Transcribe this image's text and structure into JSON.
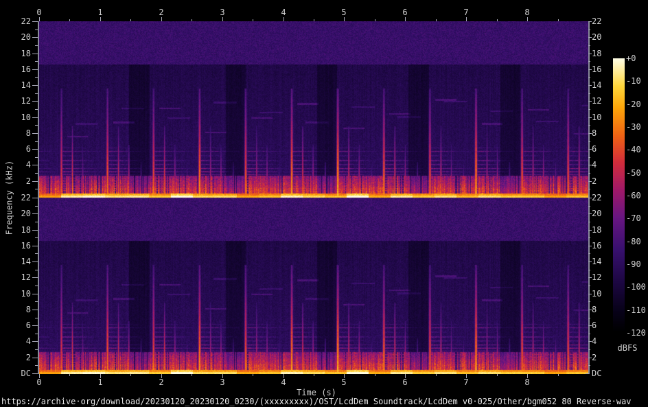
{
  "meta": {
    "app": "audio spectrogram view",
    "description": "Dual-channel (stereo) audio spectrogram with dBFS colorbar"
  },
  "colors": {
    "background": "#000000",
    "text": "#d2d2d2",
    "tick": "#a8a8b8",
    "border": "#8a8a9c",
    "footer_text": "#e6e6e6"
  },
  "footer": {
    "source_text": "https://archive·org/download/20230120_20230120_0230/(xxxxxxxxx)/OST/LcdDem Soundtrack/LcdDem v0·025/Other/bgm052 80 Reverse·wav"
  },
  "chart_data": {
    "type": "heatmap",
    "subtype": "stereo-audio-spectrogram",
    "channels": 2,
    "x_axis": {
      "label": "Time (s)",
      "min": 0,
      "max": 9.0,
      "major_ticks": [
        0,
        1,
        2,
        3,
        4,
        5,
        6,
        7,
        8
      ],
      "major_tick_labels": [
        "0",
        "1",
        "2",
        "3",
        "4",
        "5",
        "6",
        "7",
        "8"
      ],
      "minor_tick_step": 0.5
    },
    "y_axis": {
      "label": "Frequency (kHz)",
      "min_khz": 0,
      "max_khz": 22,
      "major_tick_labels": [
        "22",
        "20",
        "18",
        "16",
        "14",
        "12",
        "10",
        "8",
        "6",
        "4",
        "2"
      ],
      "bottom_label": "DC",
      "major_step_khz": 2,
      "minor_step_khz": 1,
      "labels_on_both_sides": true
    },
    "colorbar": {
      "label": "dBFS",
      "max_db": 0,
      "min_db": -120,
      "tick_labels": [
        "+0",
        "-10",
        "-20",
        "-30",
        "-40",
        "-50",
        "-60",
        "-70",
        "-80",
        "-90",
        "-100",
        "-110",
        "-120"
      ]
    },
    "palette_stops": [
      [
        0.0,
        "#000000"
      ],
      [
        0.08,
        "#08021a"
      ],
      [
        0.18,
        "#1c0741"
      ],
      [
        0.3,
        "#37106e"
      ],
      [
        0.42,
        "#691682"
      ],
      [
        0.52,
        "#a01969"
      ],
      [
        0.62,
        "#d22d3c"
      ],
      [
        0.72,
        "#f06414"
      ],
      [
        0.82,
        "#fca50a"
      ],
      [
        0.9,
        "#ffd73c"
      ],
      [
        1.0,
        "#ffffe6"
      ]
    ],
    "content": {
      "description": "Repeating reversed-percussion music: bright vertical onset streaks to ~13 kHz, dense harmonic lines below ~7 kHz, broad red band below ~2.7 kHz, bright yellow-white band at DC, purple noise floor above ~17 kHz, periodic darker quiet columns.",
      "onset_start_s": 0.36,
      "onset_period_s": 0.755,
      "num_periods": 12,
      "onset_pattern": [
        {
          "dt": 0.0,
          "top_khz": 13.0,
          "strength": 0.8
        },
        {
          "dt": 0.18,
          "top_khz": 8.5,
          "strength": 0.7
        },
        {
          "dt": 0.35,
          "top_khz": 6.3,
          "strength": 0.64
        },
        {
          "dt": 0.55,
          "top_khz": 4.2,
          "strength": 0.58
        }
      ],
      "quiet_intervals": [
        [
          1.47,
          1.8
        ],
        [
          3.05,
          3.38
        ],
        [
          4.55,
          4.88
        ],
        [
          6.05,
          6.38
        ],
        [
          7.55,
          7.88
        ]
      ],
      "harmonic_lines": [
        [
          6.2,
          0.34
        ],
        [
          5.75,
          0.42
        ],
        [
          5.2,
          0.36
        ],
        [
          4.6,
          0.46
        ],
        [
          4.1,
          0.4
        ],
        [
          3.6,
          0.44
        ],
        [
          3.2,
          0.5
        ],
        [
          2.85,
          0.44
        ],
        [
          2.4,
          0.5
        ],
        [
          2.05,
          0.52
        ],
        [
          1.7,
          0.52
        ],
        [
          1.4,
          0.55
        ],
        [
          1.1,
          0.58
        ],
        [
          0.85,
          0.55
        ]
      ],
      "noise_floor_db_approx": -85,
      "dc_band_db_approx": -8
    }
  }
}
